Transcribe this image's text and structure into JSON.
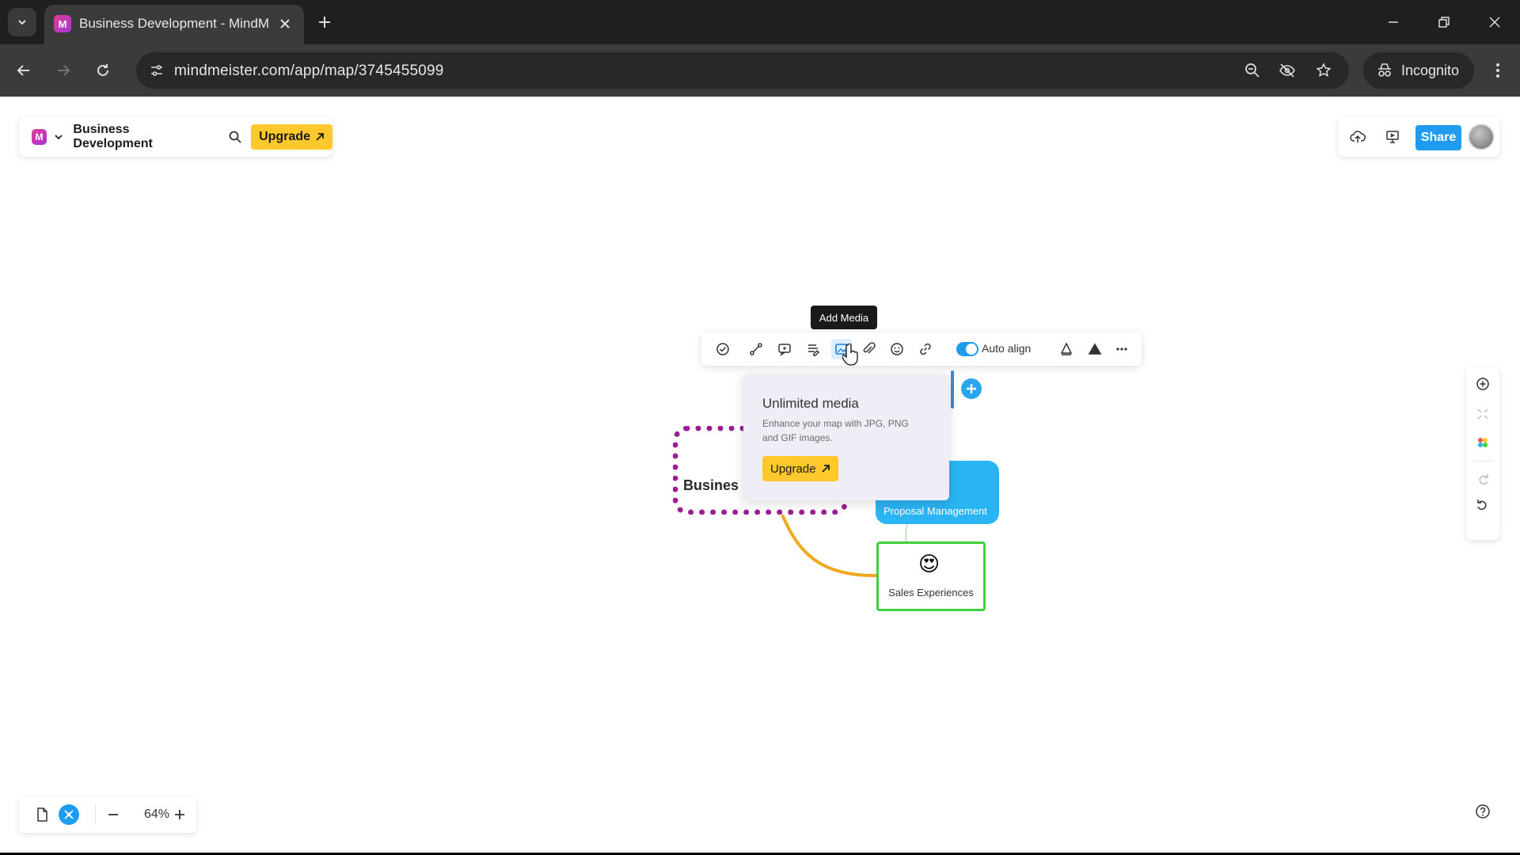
{
  "browser": {
    "tab_title": "Business Development - MindMeister",
    "url": "mindmeister.com/app/map/3745455099",
    "incognito_label": "Incognito"
  },
  "app": {
    "doc_title": "Business Development",
    "upgrade_label": "Upgrade",
    "share_label": "Share",
    "tooltip": "Add Media",
    "auto_align_label": "Auto align",
    "auto_align_on": true,
    "accent_color": "#1f9cf0",
    "upgrade_color": "#ffc82c"
  },
  "mindmap": {
    "central_label": "Busines",
    "nodes": [
      {
        "label": "Proposal Management",
        "color": "#2ab4f3"
      },
      {
        "label": "Sales Experiences",
        "emoji": "😍",
        "border_color": "#3fd23d"
      }
    ],
    "central_border_color": "#9a1f95",
    "connector_color": "#f0a81c"
  },
  "popover": {
    "title": "Unlimited media",
    "text": "Enhance your map with JPG, PNG and GIF images.",
    "button_label": "Upgrade"
  },
  "zoom": {
    "value": "64%"
  },
  "icons": {
    "node_toolbar": [
      "task-icon",
      "connect-icon",
      "comment-icon",
      "notes-icon",
      "media-icon",
      "attachment-icon",
      "emoji-icon",
      "link-icon",
      "style-icon",
      "warning-icon",
      "more-icon"
    ],
    "vertical_tools": [
      "add-icon",
      "collapse-icon",
      "theme-icon",
      "redo-icon",
      "undo-icon"
    ]
  }
}
